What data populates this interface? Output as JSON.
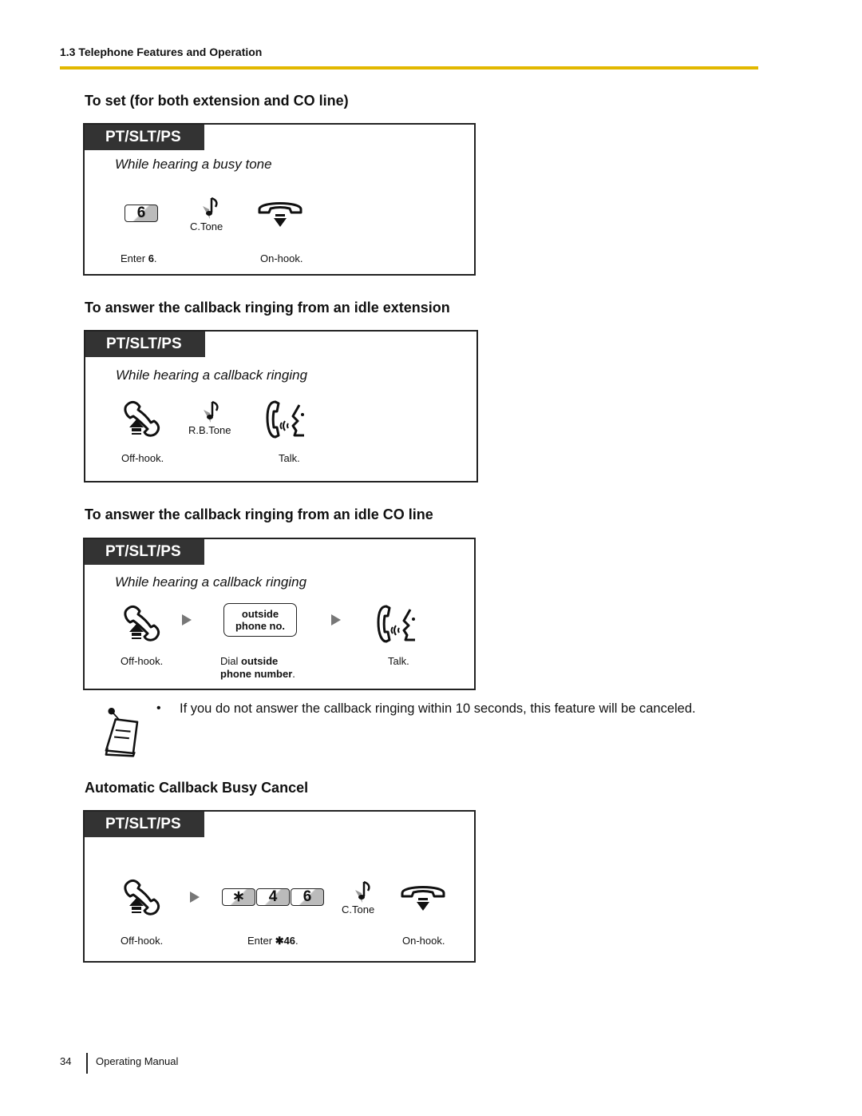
{
  "header": {
    "section": "1.3 Telephone Features and Operation",
    "rule_color": "#e2b800"
  },
  "sections": [
    {
      "title": "To set (for both extension and CO line)",
      "tag": "PT/SLT/PS",
      "condition": "While hearing a busy tone",
      "steps": [
        {
          "icon": "key-6-icon",
          "key": "6",
          "caption_prefix": "Enter ",
          "caption_bold": "6",
          "caption_suffix": "."
        },
        {
          "icon": "confirmation-tone-icon",
          "label": "C.Tone"
        },
        {
          "icon": "on-hook-icon",
          "caption": "On-hook."
        }
      ]
    },
    {
      "title": "To answer the callback ringing from an idle extension",
      "tag": "PT/SLT/PS",
      "condition": "While hearing a callback ringing",
      "steps": [
        {
          "icon": "off-hook-icon",
          "caption": "Off-hook."
        },
        {
          "icon": "ringback-tone-icon",
          "label": "R.B.Tone"
        },
        {
          "icon": "talk-icon",
          "caption": "Talk."
        }
      ]
    },
    {
      "title": "To answer the callback ringing from an idle CO line",
      "tag": "PT/SLT/PS",
      "condition": "While hearing a callback ringing",
      "steps": [
        {
          "icon": "off-hook-icon",
          "caption": "Off-hook."
        },
        {
          "icon": "outside-phone-number-button",
          "button_line1": "outside",
          "button_line2": "phone no.",
          "caption_prefix": "Dial ",
          "caption_bold1": "outside",
          "caption_bold2": "phone number",
          "caption_suffix": "."
        },
        {
          "icon": "talk-icon",
          "caption": "Talk."
        }
      ]
    },
    {
      "title": "Automatic Callback Busy Cancel",
      "tag": "PT/SLT/PS",
      "steps": [
        {
          "icon": "off-hook-icon",
          "caption": "Off-hook."
        },
        {
          "icon": "keys-star-4-6",
          "keys": [
            "∗",
            "4",
            "6"
          ],
          "caption_prefix": "Enter ",
          "caption_bold": "✱46",
          "caption_suffix": "."
        },
        {
          "icon": "confirmation-tone-icon",
          "label": "C.Tone"
        },
        {
          "icon": "on-hook-icon",
          "caption": "On-hook."
        }
      ]
    }
  ],
  "note": {
    "icon": "note-icon",
    "bullet": "•",
    "text": "If you do not answer the callback ringing within 10 seconds, this feature will be canceled."
  },
  "footer": {
    "page_number": "34",
    "title": "Operating Manual"
  }
}
